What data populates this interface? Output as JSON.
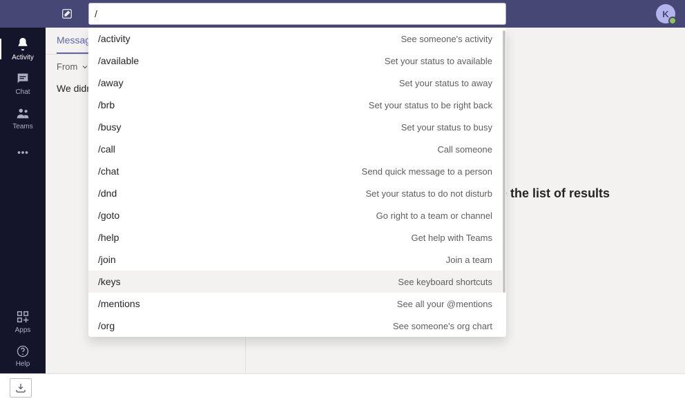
{
  "search": {
    "value": "/"
  },
  "avatar": {
    "initial": "K"
  },
  "rail": {
    "items": [
      {
        "label": "Activity"
      },
      {
        "label": "Chat"
      },
      {
        "label": "Teams"
      }
    ],
    "apps": "Apps",
    "help": "Help"
  },
  "chatPanel": {
    "tabs": [
      {
        "label": "Messages"
      }
    ],
    "filterLabel": "From",
    "emptyText": "We didn't find any matches."
  },
  "main": {
    "hint": "Select a message to read it\nUse the list of results on the left"
  },
  "commands": [
    {
      "name": "/activity",
      "desc": "See someone's activity"
    },
    {
      "name": "/available",
      "desc": "Set your status to available"
    },
    {
      "name": "/away",
      "desc": "Set your status to away"
    },
    {
      "name": "/brb",
      "desc": "Set your status to be right back"
    },
    {
      "name": "/busy",
      "desc": "Set your status to busy"
    },
    {
      "name": "/call",
      "desc": "Call someone"
    },
    {
      "name": "/chat",
      "desc": "Send quick message to a person"
    },
    {
      "name": "/dnd",
      "desc": "Set your status to do not disturb"
    },
    {
      "name": "/goto",
      "desc": "Go right to a team or channel"
    },
    {
      "name": "/help",
      "desc": "Get help with Teams"
    },
    {
      "name": "/join",
      "desc": "Join a team"
    },
    {
      "name": "/keys",
      "desc": "See keyboard shortcuts"
    },
    {
      "name": "/mentions",
      "desc": "See all your @mentions"
    },
    {
      "name": "/org",
      "desc": "See someone's org chart"
    }
  ],
  "hoveredCommand": "/keys"
}
